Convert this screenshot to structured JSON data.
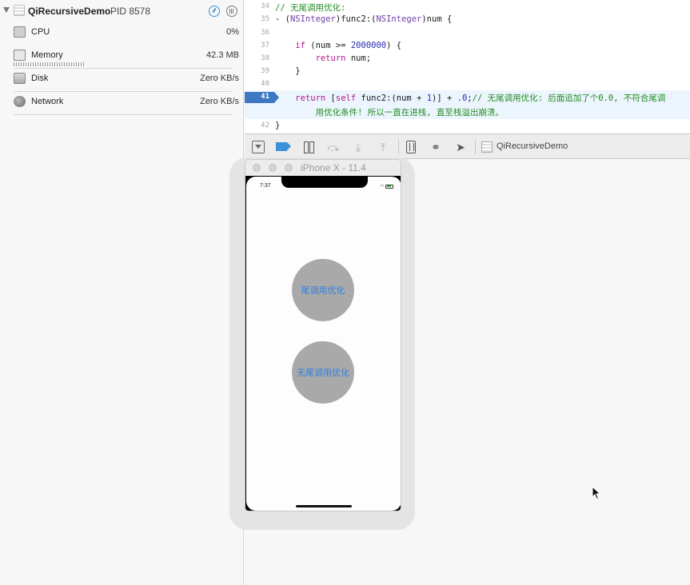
{
  "navigator": {
    "process_name": "QiRecursiveDemo",
    "process_pid": "PID 8578",
    "gauges": [
      {
        "label": "CPU",
        "value": "0%"
      },
      {
        "label": "Memory",
        "value": "42.3 MB"
      },
      {
        "label": "Disk",
        "value": "Zero KB/s"
      },
      {
        "label": "Network",
        "value": "Zero KB/s"
      }
    ]
  },
  "editor": {
    "current_line": "41",
    "lines": [
      {
        "num": "34"
      },
      {
        "num": "35"
      },
      {
        "num": "36"
      },
      {
        "num": "37"
      },
      {
        "num": "38"
      },
      {
        "num": "39"
      },
      {
        "num": "40"
      },
      {
        "num": "41"
      },
      {
        "num": "42"
      }
    ],
    "tokens": {
      "l34_comment": "// 无尾调用优化:",
      "l35_a": "- (",
      "l35_type1": "NSInteger",
      "l35_b": ")func2:(",
      "l35_type2": "NSInteger",
      "l35_c": ")num {",
      "l37_pad": "    ",
      "l37_if": "if",
      "l37_a": " (num >= ",
      "l37_num": "2000000",
      "l37_b": ") {",
      "l38_pad": "        ",
      "l38_return": "return",
      "l38_a": " num;",
      "l39": "    }",
      "l41_pad": "    ",
      "l41_return": "return",
      "l41_a": " [",
      "l41_self": "self",
      "l41_b": " func2:(num + ",
      "l41_one": "1",
      "l41_c": ")] + ",
      "l41_zero": ".0",
      "l41_d": ";",
      "l41_comment": "// 无尾调用优化: 后面追加了个0.0, 不符合尾调",
      "l41_wrap": "        用优化条件! 所以一直在进栈, 直至栈溢出崩溃。",
      "l42": "}"
    }
  },
  "debugbar": {
    "scheme_label": "QiRecursiveDemo",
    "icons": [
      "console-toggle-icon",
      "breakpoints-icon",
      "pause-icon",
      "step-over-icon",
      "step-into-icon",
      "step-out-icon",
      "view-debugger-icon",
      "memory-graph-icon",
      "location-icon",
      "scheme-icon"
    ]
  },
  "simulator": {
    "title": "iPhone X - 11.4",
    "status_time": "7:37",
    "button_tail": "尾调用优化",
    "button_no_tail": "无尾调用优化",
    "colors": {
      "button_bg": "#a9a9a9",
      "button_text": "#2f7fe0"
    }
  }
}
